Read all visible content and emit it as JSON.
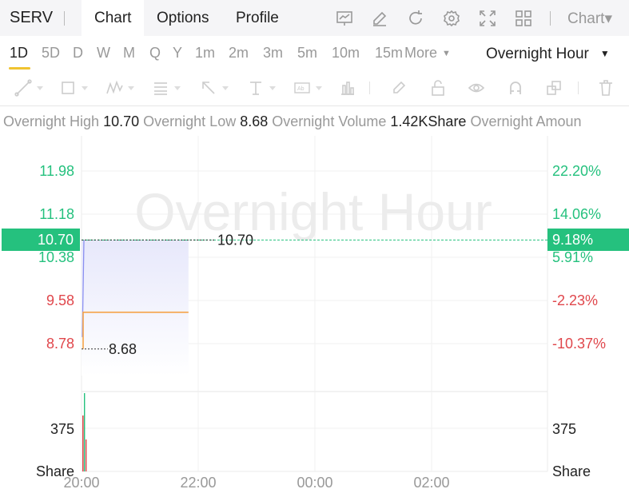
{
  "header": {
    "symbol": "SERV",
    "tabs": [
      {
        "label": "Chart",
        "active": true
      },
      {
        "label": "Options",
        "active": false
      },
      {
        "label": "Profile",
        "active": false
      }
    ],
    "icons": [
      "indicator-icon",
      "draw-pen-icon",
      "refresh-icon",
      "settings-icon",
      "fullscreen-icon",
      "layout-grid-icon"
    ],
    "chart_type_label": "Chart▾"
  },
  "periods": {
    "items": [
      "1D",
      "5D",
      "D",
      "W",
      "M",
      "Q",
      "Y",
      "1m",
      "2m",
      "3m",
      "5m",
      "10m",
      "15m"
    ],
    "active": "1D",
    "more_label": "More",
    "session_label": "Overnight Hour"
  },
  "drawing_tools": [
    "trend-line-icon",
    "rectangle-icon",
    "pattern-icon",
    "fib-icon",
    "arrow-icon",
    "text-icon",
    "price-label-icon",
    "bar-pattern-icon",
    "brush-icon",
    "lock-icon",
    "eye-icon",
    "magnet-icon",
    "clone-icon",
    "trash-icon"
  ],
  "info": {
    "high_label": "Overnight High",
    "high_value": "10.70",
    "low_label": "Overnight Low",
    "low_value": "8.68",
    "volume_label": "Overnight Volume",
    "volume_value": "1.42KShare",
    "amount_label": "Overnight Amoun"
  },
  "colors": {
    "up": "#25c17e",
    "down": "#e0474c",
    "price_line": "#f5a449",
    "area_line": "#8a8ff0",
    "cursor": "#25c17e"
  },
  "chart_data": {
    "type": "line",
    "watermark": "Overnight Hour",
    "x_ticks": [
      "20:00",
      "22:00",
      "00:00",
      "02:00"
    ],
    "y_ticks_left": [
      {
        "label": "11.98",
        "value": 11.98,
        "dir": "up"
      },
      {
        "label": "11.18",
        "value": 11.18,
        "dir": "up"
      },
      {
        "label": "10.38",
        "value": 10.38,
        "dir": "up"
      },
      {
        "label": "9.58",
        "value": 9.58,
        "dir": "down"
      },
      {
        "label": "8.78",
        "value": 8.78,
        "dir": "down"
      }
    ],
    "y_ticks_right": [
      {
        "label": "22.20%",
        "dir": "up"
      },
      {
        "label": "14.06%",
        "dir": "up"
      },
      {
        "label": "5.91%",
        "dir": "up"
      },
      {
        "label": "-2.23%",
        "dir": "down"
      },
      {
        "label": "-10.37%",
        "dir": "down"
      }
    ],
    "current_price": "10.70",
    "current_change": "9.18%",
    "high_marker": "10.70",
    "low_marker": "8.68",
    "price_series": [
      {
        "t": "20:00",
        "v": 8.68
      },
      {
        "t": "20:01",
        "v": 10.7
      },
      {
        "t": "20:03",
        "v": 9.36
      },
      {
        "t": "21:50",
        "v": 9.36
      }
    ],
    "volume_axis_left": [
      "375",
      "Share"
    ],
    "volume_axis_right": [
      "375",
      "Share"
    ]
  }
}
